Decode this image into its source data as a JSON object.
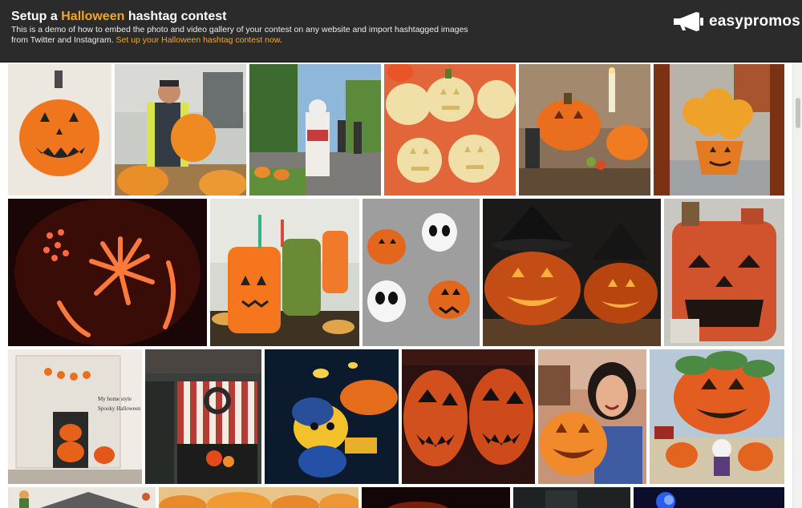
{
  "header": {
    "title_prefix": "Setup a ",
    "title_accent": "Halloween",
    "title_suffix": " hashtag contest",
    "description": "This is a demo of how to embed the photo and video gallery of your contest on any website and import hashtagged images from Twitter and Instagram. ",
    "cta_link": "Set up your Halloween hashtag contest now",
    "cta_after": "."
  },
  "logo": {
    "text": "easypromos",
    "icon": "megaphone-icon"
  },
  "colors": {
    "header_bg": "#2b2b2b",
    "accent": "#f5a623"
  },
  "gallery": {
    "tiles": [
      "pumpkin-drawing",
      "man-holding-pumpkin",
      "zombie-bride-street",
      "jack-o-lantern-cookies",
      "pumpkin-table-decor",
      "mums-pumpkin-pot",
      "carved-pumpkin-fireworks",
      "monster-drink-jars",
      "skull-pumpkin-candies",
      "witch-hat-pumpkins",
      "gas-can-jack-o-lantern",
      "spooky-halloween-shelf",
      "striped-window-wreath",
      "night-ride-figure",
      "pumpkin-face-paint",
      "woman-with-jack-o-lantern",
      "jack-o-lantern-painting",
      "scarecrow-house",
      "pumpkin-pile",
      "dark-pumpkin",
      "dark-room",
      "blue-light-figure"
    ]
  },
  "annotations": {
    "my_home_style": "My home style",
    "spooky_decorations": "Spooky Halloween Decorations"
  }
}
